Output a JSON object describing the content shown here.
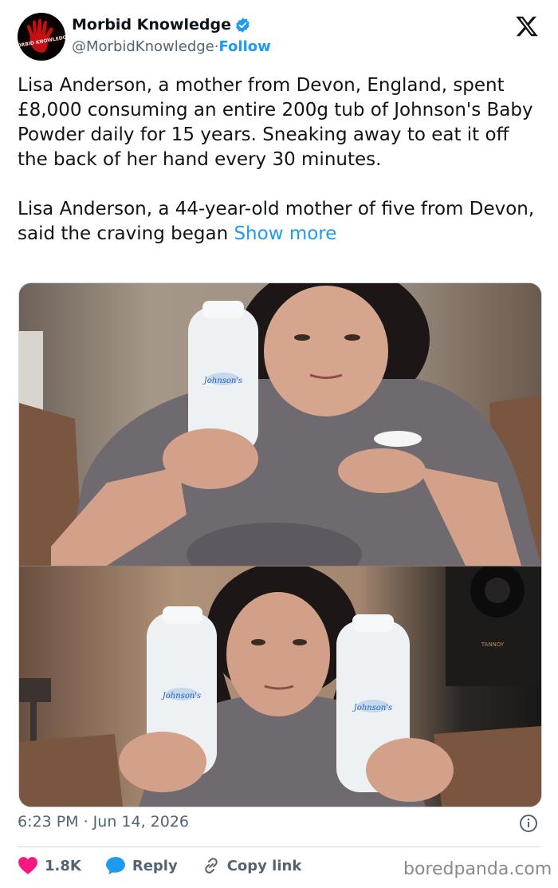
{
  "author": {
    "name": "Morbid Knowledge",
    "handle": "@MorbidKnowledge",
    "separator": " · ",
    "follow_label": "Follow",
    "avatar_text": "MORBID KNOWLEDGE"
  },
  "brand": {
    "logo": "X",
    "verified_color": "#1d9bf0",
    "accent": "#1d9bf0",
    "like_color": "#f91880"
  },
  "tweet": {
    "paragraph_1": "Lisa Anderson, a mother from Devon, England, spent £8,000 consuming an entire 200g tub of Johnson's Baby Powder daily for 15 years. Sneaking away to eat it off the back of her hand every 30 minutes.",
    "paragraph_2": "Lisa Anderson, a 44-year-old mother of five from Devon, said the craving began ",
    "show_more": "Show more"
  },
  "media": {
    "bottle_label": "Johnson's",
    "speaker_brand": "TANNOY"
  },
  "timestamp": "6:23 PM · Jun 14, 2026",
  "actions": {
    "likes": "1.8K",
    "reply": "Reply",
    "copy_link": "Copy link"
  },
  "icons": [
    "verified-badge-icon",
    "x-logo-icon",
    "info-icon",
    "heart-icon",
    "reply-bubble-icon",
    "link-icon"
  ],
  "watermark": "boredpanda.com"
}
